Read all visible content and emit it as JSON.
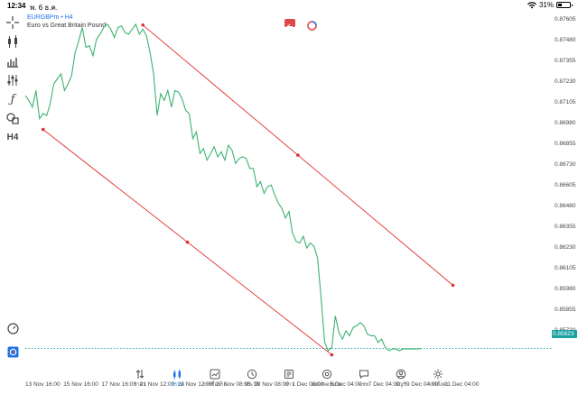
{
  "status": {
    "time": "12:34",
    "date": "พ. 6 ธ.ค.",
    "battery": "31%"
  },
  "symbol": {
    "name": "EURGBPm • H4",
    "description": "Euro vs Great Britain Pound"
  },
  "toolbar": {
    "timeframe": "H4"
  },
  "colors": {
    "price_line": "#3cb371",
    "trend_line": "#e03030",
    "accent": "#1e73e8",
    "current_price_bg": "#1aa3a3"
  },
  "price_axis": [
    "0.87605",
    "0.87480",
    "0.87355",
    "0.87230",
    "0.87105",
    "0.86980",
    "0.86855",
    "0.86730",
    "0.86605",
    "0.86480",
    "0.86355",
    "0.86230",
    "0.86105",
    "0.85980",
    "0.85855",
    "0.85730"
  ],
  "current_price": "0.85623",
  "time_axis": [
    "13 Nov 16:00",
    "15 Nov 16:00",
    "17 Nov 16:00",
    "21 Nov 12:00",
    "23 Nov 12:00",
    "27 Nov 08:00",
    "29 Nov 08:00",
    "1 Dec 08:00",
    "5 Dec 04:00",
    "7 Dec 04:00",
    "9 Dec 04:00",
    "11 Dec 04:00"
  ],
  "nav": [
    {
      "label": "ราคา",
      "icon": "quotes-icon"
    },
    {
      "label": "กราฟ",
      "icon": "chart-icon",
      "active": true
    },
    {
      "label": "การซื้อขาย",
      "icon": "trade-icon"
    },
    {
      "label": "ประวัติ",
      "icon": "history-icon"
    },
    {
      "label": "ข่าว",
      "icon": "news-icon"
    },
    {
      "label": "กล่องจดหมาย",
      "icon": "mailbox-icon"
    },
    {
      "label": "แชท",
      "icon": "chat-icon"
    },
    {
      "label": "บัญชี",
      "icon": "account-icon"
    },
    {
      "label": "การตั้งค่า",
      "icon": "settings-icon"
    }
  ],
  "chart_data": {
    "type": "line",
    "x": [
      0,
      1,
      2,
      3,
      4,
      5,
      6,
      7,
      8,
      9,
      10,
      11,
      12,
      13,
      14,
      15,
      16,
      17,
      18,
      19,
      20,
      21,
      22,
      23,
      24,
      25,
      26,
      27,
      28,
      29,
      30,
      31,
      32,
      33,
      34,
      35,
      36,
      37,
      38,
      39,
      40,
      41,
      42,
      43,
      44,
      45,
      46,
      47,
      48,
      49,
      50,
      51,
      52,
      53,
      54,
      55,
      56,
      57,
      58,
      59,
      60,
      61,
      62,
      63,
      64,
      65,
      66,
      67,
      68,
      69,
      70,
      71,
      72,
      73,
      74,
      75,
      76,
      77,
      78,
      79,
      80,
      81,
      82,
      83,
      84,
      85,
      86,
      87,
      88,
      89,
      90,
      91,
      92,
      93,
      94,
      95,
      96,
      97,
      98,
      99,
      100,
      101,
      102,
      103,
      104,
      105,
      106,
      107,
      108,
      109,
      110,
      111
    ],
    "values": [
      0.8715,
      0.8712,
      0.8708,
      0.8718,
      0.8701,
      0.8704,
      0.8703,
      0.871,
      0.8722,
      0.8725,
      0.8728,
      0.8718,
      0.8722,
      0.8727,
      0.8741,
      0.8748,
      0.8756,
      0.8744,
      0.8745,
      0.8739,
      0.8749,
      0.8752,
      0.8756,
      0.8758,
      0.8755,
      0.875,
      0.8756,
      0.8757,
      0.8753,
      0.8752,
      0.8755,
      0.8758,
      0.8752,
      0.8755,
      0.8751,
      0.8741,
      0.8728,
      0.8703,
      0.8716,
      0.8712,
      0.8718,
      0.8708,
      0.8718,
      0.8717,
      0.8713,
      0.8706,
      0.8704,
      0.8689,
      0.8693,
      0.868,
      0.8683,
      0.8676,
      0.868,
      0.8684,
      0.8678,
      0.8681,
      0.8676,
      0.8685,
      0.8682,
      0.8674,
      0.8677,
      0.8678,
      0.8677,
      0.8671,
      0.8671,
      0.866,
      0.8663,
      0.8656,
      0.866,
      0.8661,
      0.8655,
      0.865,
      0.8647,
      0.8641,
      0.8645,
      0.8632,
      0.8627,
      0.8626,
      0.863,
      0.8623,
      0.8626,
      0.8624,
      0.8617,
      0.8593,
      0.8566,
      0.8561,
      0.8563,
      0.8582,
      0.8572,
      0.8568,
      0.8573,
      0.857,
      0.8575,
      0.8576,
      0.8578,
      0.8576,
      0.8571,
      0.857,
      0.857,
      0.8566,
      0.8568,
      0.8563,
      0.8561,
      0.8562,
      0.8562,
      0.8561,
      0.8562,
      0.8562,
      0.8562,
      0.8562,
      0.8562,
      0.85623
    ],
    "ylim": [
      0.8555,
      0.8765
    ],
    "trendlines": [
      {
        "x1": 5,
        "y1": 0.86945,
        "x2": 86,
        "y2": 0.85585
      },
      {
        "x1": 33,
        "y1": 0.87575,
        "x2": 120,
        "y2": 0.86005
      }
    ],
    "grid": false,
    "title": "EURGBPm • H4"
  }
}
